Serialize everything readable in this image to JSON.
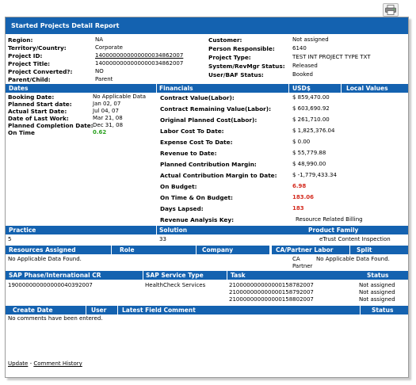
{
  "report": {
    "title": "Started Projects Detail Report",
    "print_icon": "printer-icon"
  },
  "summary_left": [
    {
      "label": "Region:",
      "value": "NA"
    },
    {
      "label": "Territory/Country:",
      "value": "Corporate"
    },
    {
      "label": "Project ID:",
      "value": "1400000000000000034862007"
    },
    {
      "label": "Project Title:",
      "value": "1400000000000000034862007"
    },
    {
      "label": "Project Converted?:",
      "value": "NO"
    },
    {
      "label": "Parent/Child:",
      "value": "Parent"
    }
  ],
  "summary_right": [
    {
      "label": "Customer:",
      "value": "Not assigned"
    },
    {
      "label": "Person Responsible:",
      "value": "6140"
    },
    {
      "label": "Project Type:",
      "value": "TEST INT PROJECT TYPE TXT"
    },
    {
      "label": "System/RevMgr Status:",
      "value": "Released"
    },
    {
      "label": "User/BAF Status:",
      "value": "Booked"
    }
  ],
  "dates_header": {
    "dates": "Dates",
    "financials": "Financials",
    "usd": "USD$",
    "local": "Local Values"
  },
  "dates": [
    {
      "label": "Booking Date:",
      "value": "No Applicable Data"
    },
    {
      "label": "Planned Start date:",
      "value": "Jan 02, 07"
    },
    {
      "label": "Actual Start Date:",
      "value": "Jul 04, 07"
    },
    {
      "label": "Date of Last Work:",
      "value": "Mar 21, 08"
    },
    {
      "label": "Planned Completion Date:",
      "value": "Dec 31, 08"
    },
    {
      "label": "On Time",
      "value": "0.62"
    }
  ],
  "financials": [
    {
      "label": "Contract Value(Labor):",
      "value": "$ 859,470.00"
    },
    {
      "label": "Contract Remaining Value(Labor):",
      "value": "$ 603,690.92"
    },
    {
      "label": "Original Planned Cost(Labor):",
      "value": "$ 261,710.00"
    },
    {
      "label": "Labor Cost To Date:",
      "value": "$ 1,825,376.04"
    },
    {
      "label": "Expense Cost To Date:",
      "value": "$ 0.00"
    },
    {
      "label": "Revenue to Date:",
      "value": "$ 55,779.88"
    },
    {
      "label": "Planned Contribution Margin:",
      "value": "$ 48,990.00"
    },
    {
      "label": "Actual Contribution Margin to Date:",
      "value": "$ -1,779,433.34"
    },
    {
      "label": "On Budget:",
      "value": "6.98"
    },
    {
      "label": "On Time & On Budget:",
      "value": "183.06"
    },
    {
      "label": "Days Lapsed:",
      "value": "183"
    },
    {
      "label": "Revenue Analysis Key:",
      "value": "Resource Related Billing"
    }
  ],
  "practice_header": {
    "practice": "Practice",
    "solution": "Solution",
    "product_family": "Product Family"
  },
  "practice_row": {
    "practice": "5",
    "solution": "33",
    "product_family": "eTrust Content Inspection"
  },
  "resources_header": {
    "resources": "Resources Assigned",
    "role": "Role",
    "company": "Company",
    "ca_partner": "CA/Partner Labor",
    "split": "Split"
  },
  "resources_row": {
    "resources": "No Applicable Data Found.",
    "ca_partner_1": "CA",
    "ca_partner_2": "Partner",
    "split": "No Applicable Data Found."
  },
  "sap_header": {
    "phase": "SAP Phase/International CR",
    "service": "SAP Service Type",
    "task": "Task",
    "status": "Status"
  },
  "sap_rows": {
    "phase": "190000000000000040392007",
    "service": "HealthCheck Services",
    "tasks": [
      {
        "task": "210000000000000158782007",
        "status": "Not assigned"
      },
      {
        "task": "210000000000000158792007",
        "status": "Not assigned"
      },
      {
        "task": "210000000000000158802007",
        "status": "Not assigned"
      }
    ]
  },
  "comments_header": {
    "create_date": "Create Date",
    "user": "User",
    "latest": "Latest Field Comment",
    "status": "Status"
  },
  "comments_empty": "No comments have been entered.",
  "footer": {
    "update": "Update",
    "dash": " - ",
    "history": "Comment History"
  },
  "colors": {
    "header_blue": "#1462b0",
    "on_time_green": "#2aa11f",
    "budget_red": "#d42b1f"
  }
}
